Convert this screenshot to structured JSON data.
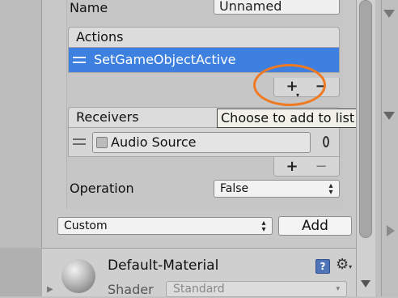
{
  "name_row": {
    "label": "Name",
    "value": "Unnamed"
  },
  "actions_list": {
    "header": "Actions",
    "items": [
      {
        "label": "SetGameObjectActive",
        "selected": true
      }
    ],
    "add_symbol": "+",
    "remove_symbol": "−"
  },
  "tooltip": {
    "text": "Choose to add to list"
  },
  "receivers_list": {
    "header": "Receivers",
    "items": [
      {
        "label": "Audio Source",
        "icon": "cube-icon"
      }
    ],
    "picker_symbol": "⊙",
    "add_symbol": "+",
    "remove_symbol": "−"
  },
  "operation_row": {
    "label": "Operation",
    "value": "False"
  },
  "add_row": {
    "dropdown_value": "Custom",
    "add_button": "Add"
  },
  "material": {
    "name": "Default-Material",
    "shader_label": "Shader",
    "shader_value": "Standard",
    "help_symbol": "?",
    "gear_symbol": "⚙"
  },
  "colors": {
    "selection": "#3d80df",
    "annotation": "#f07a22",
    "panel": "#c8c8c8"
  }
}
